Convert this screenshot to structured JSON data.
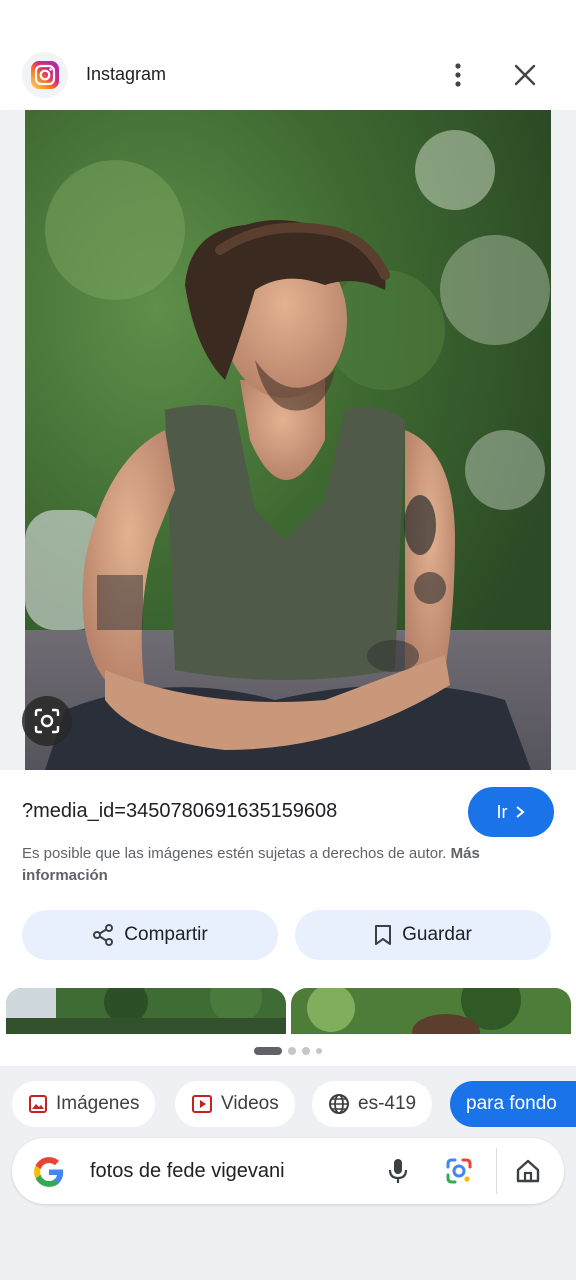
{
  "header": {
    "source_name": "Instagram",
    "more_icon": "more-vert-icon",
    "close_icon": "close-icon"
  },
  "result": {
    "url_title": "?media_id=3450780691635159608",
    "go_label": "Ir",
    "copyright_text": "Es posible que las imágenes estén sujetas a derechos de autor.",
    "copyright_link": "Más información"
  },
  "actions": {
    "share_label": "Compartir",
    "save_label": "Guardar"
  },
  "chips": [
    {
      "label": "Imágenes",
      "icon": "image-icon"
    },
    {
      "label": "Videos",
      "icon": "video-icon"
    },
    {
      "label": "es-419",
      "icon": "globe-icon"
    },
    {
      "label": "para fondo",
      "icon": ""
    }
  ],
  "search": {
    "query": "fotos de fede vigevani",
    "mic_icon": "mic-icon",
    "lens_icon": "lens-icon",
    "home_icon": "home-icon"
  },
  "colors": {
    "accent": "#1a73e8",
    "action_bg": "#e8f0fe",
    "bottom_bg": "#eef0f4"
  }
}
